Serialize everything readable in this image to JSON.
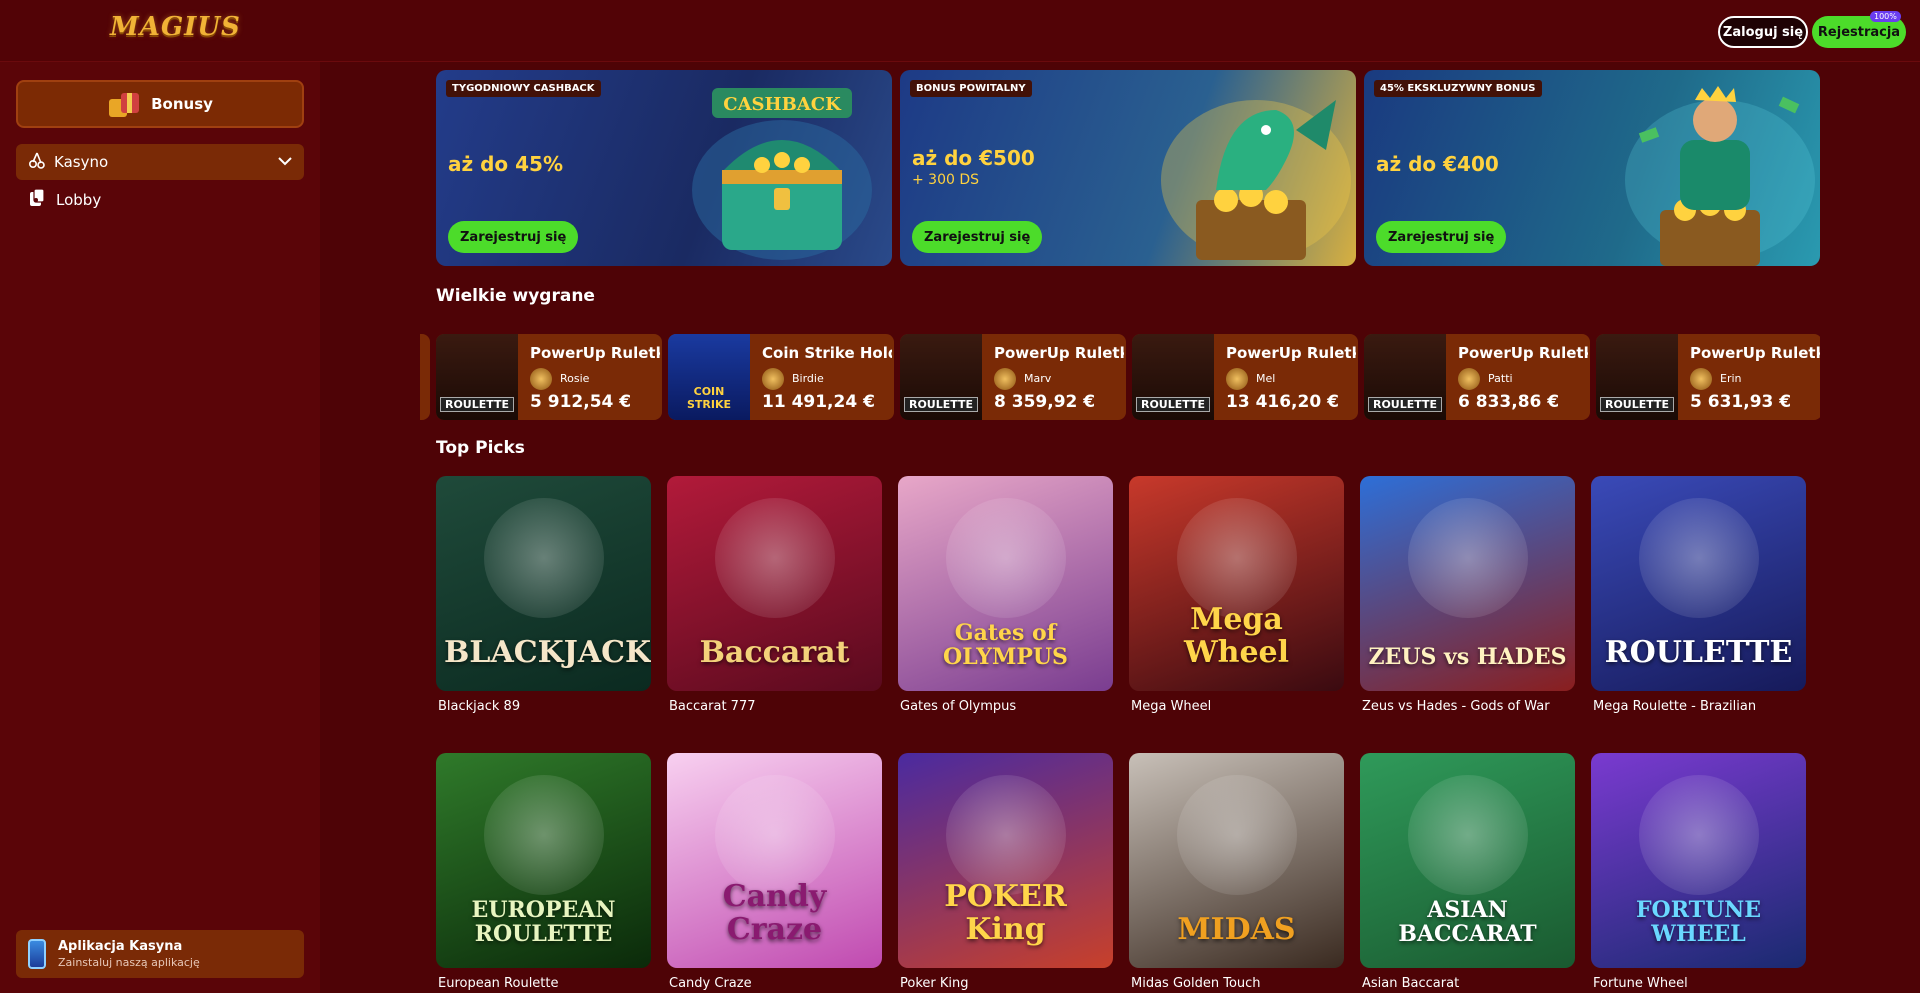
{
  "header": {
    "logo": "MAGIUS",
    "login_label": "Zaloguj się",
    "register_label": "Rejestracja",
    "register_badge": "100%"
  },
  "sidebar": {
    "bonus_label": "Bonusy",
    "casino_label": "Kasyno",
    "lobby_label": "Lobby",
    "app_title": "Aplikacja Kasyna",
    "app_subtitle": "Zainstaluj naszą aplikację"
  },
  "promos": [
    {
      "tag": "TYGODNIOWY CASHBACK",
      "amount": "aż do 45%",
      "sub": "",
      "cta": "Zarejestruj się",
      "art_text": "CASHBACK"
    },
    {
      "tag": "BONUS POWITALNY",
      "amount": "aż do €500",
      "sub": "+ 300 DS",
      "cta": "Zarejestruj się"
    },
    {
      "tag": "45% EKSKLUZYWNY BONUS",
      "amount": "aż do €400",
      "sub": "",
      "cta": "Zarejestruj się"
    }
  ],
  "big_wins": {
    "title": "Wielkie wygrane",
    "items": [
      {
        "game": "PowerUp Ruletka",
        "user": "Rosie",
        "amount": "5 912,54 €",
        "thumb_text": "ROULETTE"
      },
      {
        "game": "Coin Strike Hold",
        "user": "Birdie",
        "amount": "11 491,24 €",
        "thumb_text": "COIN STRIKE"
      },
      {
        "game": "PowerUp Ruletka",
        "user": "Marv",
        "amount": "8 359,92 €",
        "thumb_text": "ROULETTE"
      },
      {
        "game": "PowerUp Ruletka",
        "user": "Mel",
        "amount": "13 416,20 €",
        "thumb_text": "ROULETTE"
      },
      {
        "game": "PowerUp Ruletka",
        "user": "Patti",
        "amount": "6 833,86 €",
        "thumb_text": "ROULETTE"
      },
      {
        "game": "PowerUp Ruletka",
        "user": "Erin",
        "amount": "5 631,93 €",
        "thumb_text": "ROULETTE"
      }
    ]
  },
  "top_picks": {
    "title": "Top Picks",
    "games": [
      {
        "name": "Blackjack 89",
        "art": "BLACKJACK",
        "colors": [
          "#1f4a3a",
          "#0b2a20"
        ],
        "text_color": "#f5e6c8"
      },
      {
        "name": "Baccarat 777",
        "art": "Baccarat",
        "colors": [
          "#b21a3a",
          "#5a0a1e"
        ],
        "text_color": "#f3d27a"
      },
      {
        "name": "Gates of Olympus",
        "art": "Gates of OLYMPUS",
        "colors": [
          "#e8a7c8",
          "#7a3d90"
        ],
        "text_color": "#ffd54a"
      },
      {
        "name": "Mega Wheel",
        "art": "Mega Wheel",
        "colors": [
          "#c8392b",
          "#3a0a10"
        ],
        "text_color": "#ffd54a"
      },
      {
        "name": "Zeus vs Hades - Gods of War",
        "art": "ZEUS vs HADES",
        "colors": [
          "#2d6fd8",
          "#8a1e1e"
        ],
        "text_color": "#fff2c0"
      },
      {
        "name": "Mega Roulette - Brazilian",
        "art": "ROULETTE",
        "colors": [
          "#3a4ab8",
          "#161a5a"
        ],
        "text_color": "#ffffff"
      },
      {
        "name": "European Roulette",
        "art": "EUROPEAN ROULETTE",
        "colors": [
          "#2f7a2a",
          "#0b2a0a"
        ],
        "text_color": "#e8f5c0"
      },
      {
        "name": "Candy Craze",
        "art": "Candy Craze",
        "colors": [
          "#f8d0f0",
          "#c04ab0"
        ],
        "text_color": "#8a1a70"
      },
      {
        "name": "Poker King",
        "art": "POKER King",
        "colors": [
          "#4a2aa0",
          "#c8402a"
        ],
        "text_color": "#ffd54a"
      },
      {
        "name": "Midas Golden Touch",
        "art": "MIDAS",
        "colors": [
          "#c8c0b8",
          "#3a2a20"
        ],
        "text_color": "#f0a020"
      },
      {
        "name": "Asian Baccarat",
        "art": "ASIAN BACCARAT",
        "colors": [
          "#2f9a5a",
          "#1a5a30"
        ],
        "text_color": "#ffffff"
      },
      {
        "name": "Fortune Wheel",
        "art": "FORTUNE WHEEL",
        "colors": [
          "#7a3ad0",
          "#1a2a70"
        ],
        "text_color": "#6ad8ff"
      }
    ]
  },
  "colors": {
    "accent_green": "#4cdc2a",
    "background": "#4e0306",
    "card": "#7a2a06",
    "gold": "#ffd23f"
  }
}
